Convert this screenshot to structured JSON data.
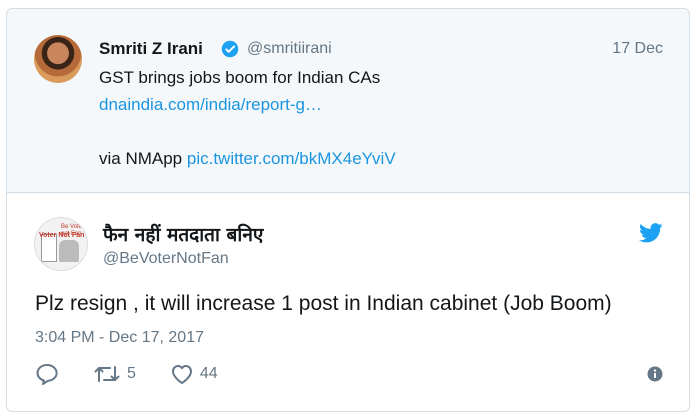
{
  "quoted_tweet": {
    "author_name": "Smriti Z Irani",
    "author_handle": "@smritiirani",
    "date": "17 Dec",
    "text": "GST brings jobs boom for Indian CAs",
    "link": "dnaindia.com/india/report-g…",
    "via_prefix": "via NMApp ",
    "via_link": "pic.twitter.com/bkMX4eYviV"
  },
  "main_tweet": {
    "author_name": "फैन नहीं मतदाता बनिए",
    "author_handle": "@BeVoterNotFan",
    "text": "Plz resign , it will increase 1 post in Indian cabinet (Job Boom)",
    "timestamp": "3:04 PM - Dec 17, 2017",
    "avatar_text_left": "Voter Not Fan",
    "avatar_text_right": "Be Voter not Fan"
  },
  "actions": {
    "reply_icon": "reply-icon",
    "retweet_icon": "retweet-icon",
    "retweet_count": "5",
    "like_icon": "heart-icon",
    "like_count": "44",
    "info_icon": "info-icon"
  },
  "colors": {
    "link": "#1b95e0",
    "twitter_blue": "#1da1f2",
    "muted": "#657786",
    "quote_bg": "#f5f8fa"
  }
}
